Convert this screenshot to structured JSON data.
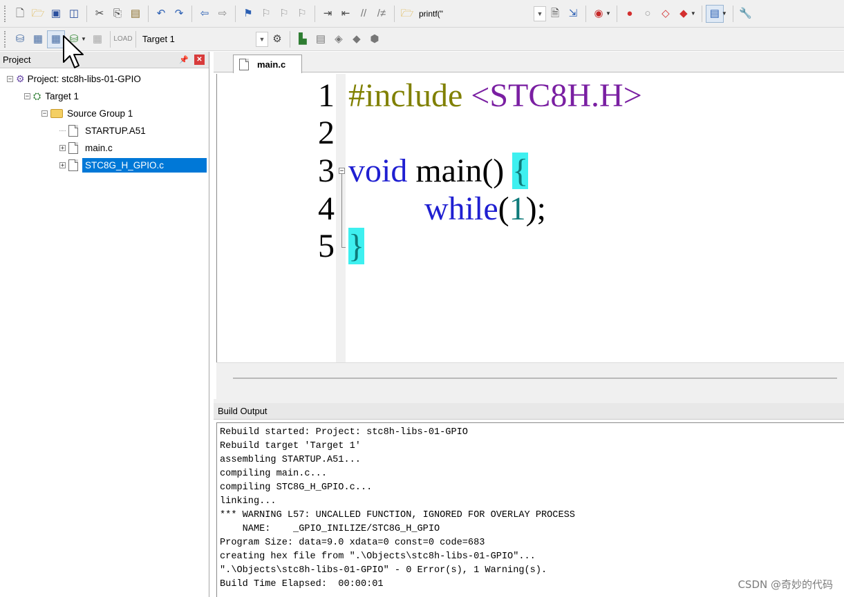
{
  "toolbar_main": {
    "find_combo_value": "printf(\"",
    "buttons": [
      {
        "name": "new-file-icon",
        "glyph": "🗋"
      },
      {
        "name": "open-folder-icon",
        "glyph": "📂"
      },
      {
        "name": "save-icon",
        "glyph": "💾"
      },
      {
        "name": "save-all-icon",
        "glyph": "🗐"
      },
      {
        "name": "cut-icon",
        "glyph": "✂"
      },
      {
        "name": "copy-icon",
        "glyph": "⎘"
      },
      {
        "name": "paste-icon",
        "glyph": "📋"
      },
      {
        "name": "undo-icon",
        "glyph": "↶"
      },
      {
        "name": "redo-icon",
        "glyph": "↷"
      },
      {
        "name": "nav-back-icon",
        "glyph": "⇦"
      },
      {
        "name": "nav-forward-icon",
        "glyph": "⇨"
      }
    ]
  },
  "toolbar_build": {
    "target_combo_value": "Target 1"
  },
  "project_pane": {
    "title": "Project",
    "tree": {
      "project": "Project: stc8h-libs-01-GPIO",
      "target": "Target 1",
      "group": "Source Group 1",
      "files": [
        "STARTUP.A51",
        "main.c",
        "STC8G_H_GPIO.c"
      ]
    }
  },
  "editor": {
    "tab_label": "main.c",
    "lines": [
      {
        "num": "1",
        "pp": "#include",
        "inc": "<STC8H.H>"
      },
      {
        "num": "2"
      },
      {
        "num": "3",
        "type": "void",
        "rest": "main()",
        "brace": "{"
      },
      {
        "num": "4",
        "kw": "while",
        "open": "(",
        "numlit": "1",
        "close": ");"
      },
      {
        "num": "5",
        "brace": "}"
      }
    ]
  },
  "build_output": {
    "title": "Build Output",
    "lines": [
      "Rebuild started: Project: stc8h-libs-01-GPIO",
      "Rebuild target 'Target 1'",
      "assembling STARTUP.A51...",
      "compiling main.c...",
      "compiling STC8G_H_GPIO.c...",
      "linking...",
      "*** WARNING L57: UNCALLED FUNCTION, IGNORED FOR OVERLAY PROCESS",
      "    NAME:    _GPIO_INILIZE/STC8G_H_GPIO",
      "Program Size: data=9.0 xdata=0 const=0 code=683",
      "creating hex file from \".\\Objects\\stc8h-libs-01-GPIO\"...",
      "\".\\Objects\\stc8h-libs-01-GPIO\" - 0 Error(s), 1 Warning(s).",
      "Build Time Elapsed:  00:00:01"
    ]
  },
  "watermark": "CSDN @奇妙的代码",
  "colors": {
    "preprocessor": "#808000",
    "include": "#7a1fa2",
    "keyword": "#1f1fd1",
    "number": "#0e7a7a",
    "brace_highlight": "#3ef0f0",
    "selection": "#0078d7"
  }
}
